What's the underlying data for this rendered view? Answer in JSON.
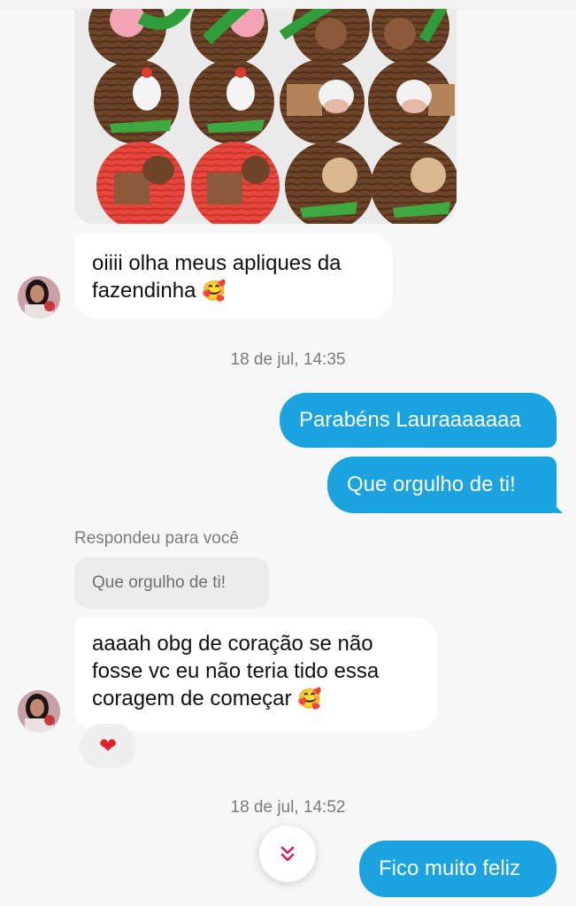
{
  "messages": {
    "received_1": {
      "text": "oiiii olha meus apliques da fazendinha",
      "emoji": "🥰"
    },
    "timestamp_1": "18 de jul, 14:35",
    "sent_1": "Parabéns Lauraaaaaaa",
    "sent_2": "Que orgulho de ti!",
    "reply": {
      "label": "Respondeu para você",
      "quote": "Que orgulho de ti!"
    },
    "received_2": {
      "text": "aaaah obg de coração se não fosse vc eu não teria tido essa coragem de começar",
      "emoji": "🥰"
    },
    "reaction": "❤",
    "timestamp_2": "18 de jul, 14:52",
    "sent_3": "Fico muito feliz"
  },
  "icons": {
    "scroll_down": "double-chevron-down-icon",
    "reaction": "heart-icon"
  },
  "colors": {
    "outgoing_bubble": "#1aa3de",
    "incoming_bubble": "#ffffff",
    "background": "#f7f7f7",
    "accent_chevron": "#d81b60"
  }
}
